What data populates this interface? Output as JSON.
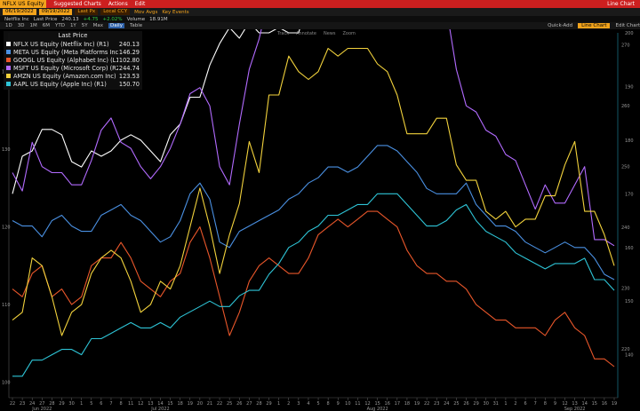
{
  "topbar": {
    "ticker": "NFLX US Equity",
    "menu": [
      "Suggested Charts",
      "Actions",
      "Edit"
    ],
    "title": "Line Chart"
  },
  "rangebar": {
    "start": "06/19/2022",
    "end": "09/19/2022",
    "field": "Last Px",
    "ccy": "Local CCY",
    "options": [
      "Mov Avgs",
      "Key Events"
    ]
  },
  "quotebar": {
    "name": "Netflix Inc",
    "label": "Last Price",
    "price": "240.13",
    "change": "+4.75",
    "pct": "+2.02%",
    "vol_label": "Volume",
    "volume": "18.91M"
  },
  "periodbar": {
    "periods": [
      "1D",
      "3D",
      "1M",
      "6M",
      "YTD",
      "1Y",
      "5Y",
      "Max"
    ],
    "freq": "Daily",
    "extra": [
      "Table"
    ],
    "right": [
      "Quick-Add",
      "Edit Chart"
    ],
    "field": "Line Chart"
  },
  "legend": {
    "header": "Last Price",
    "items": [
      {
        "name": "NFLX US Equity (Netflix Inc)  (R1)",
        "value": "240.13",
        "color": "#ffffff"
      },
      {
        "name": "META US Equity (Meta Platforms Inc)  (R1)",
        "value": "146.29",
        "color": "#4a90e2"
      },
      {
        "name": "GOOGL US Equity (Alphabet Inc)  (L1)",
        "value": "102.80",
        "color": "#e8562a"
      },
      {
        "name": "MSFT US Equity (Microsoft Corp)  (R2)",
        "value": "244.74",
        "color": "#b26bff"
      },
      {
        "name": "AMZN US Equity (Amazon.com Inc)  (L1)",
        "value": "123.53",
        "color": "#f2d23c"
      },
      {
        "name": "AAPL US Equity (Apple Inc)  (R1)",
        "value": "150.70",
        "color": "#2ec4d6"
      }
    ]
  },
  "toolbar": [
    "Track",
    "Annotate",
    "News",
    "Zoom"
  ],
  "chart_data": {
    "type": "line",
    "x_tick_labels": [
      "22",
      "23",
      "24",
      "27",
      "28",
      "29",
      "30",
      "1",
      "5",
      "6",
      "7",
      "8",
      "11",
      "12",
      "13",
      "14",
      "15",
      "18",
      "19",
      "20",
      "21",
      "22",
      "25",
      "26",
      "27",
      "28",
      "29",
      "1",
      "2",
      "3",
      "4",
      "5",
      "8",
      "9",
      "10",
      "11",
      "12",
      "15",
      "16",
      "17",
      "18",
      "19",
      "22",
      "23",
      "24",
      "25",
      "26",
      "29",
      "30",
      "31",
      "1",
      "2",
      "6",
      "7",
      "8",
      "9",
      "12",
      "13",
      "14",
      "15",
      "16",
      "19"
    ],
    "x_month_labels": [
      {
        "label": "Jun 2022",
        "index": 3
      },
      {
        "label": "Jul 2022",
        "index": 15
      },
      {
        "label": "Aug 2022",
        "index": 37
      },
      {
        "label": "Sep 2022",
        "index": 57
      }
    ],
    "left_axis": {
      "ticks": [
        100,
        110,
        120,
        130,
        140
      ],
      "range": [
        98,
        145
      ]
    },
    "right_axis_1": {
      "ticks": [
        140,
        150,
        160,
        170,
        180,
        190,
        200,
        210
      ],
      "range": [
        132,
        200
      ]
    },
    "right_axis_2": {
      "ticks": [
        220,
        230,
        240,
        250,
        260,
        270,
        280
      ],
      "range": [
        212,
        272
      ]
    },
    "series": [
      {
        "name": "NFLX US Equity (Netflix Inc)",
        "axis": "right_axis_1",
        "color": "#ffffff",
        "values": [
          170,
          177,
          178,
          182,
          182,
          181,
          176,
          175,
          178,
          177,
          178,
          180,
          181,
          180,
          178,
          176,
          181,
          183,
          188,
          188,
          194,
          198,
          201,
          199,
          202,
          200,
          200,
          201,
          200,
          200,
          206,
          215,
          221,
          223,
          225,
          228,
          225,
          229,
          228,
          227,
          222,
          219,
          210,
          210,
          212,
          211,
          215,
          211,
          211,
          215,
          212,
          213,
          213,
          212,
          214,
          214,
          217,
          218,
          214,
          214,
          222,
          224
        ]
      },
      {
        "name": "META US Equity (Meta Platforms Inc)",
        "axis": "right_axis_1",
        "color": "#4a90e2",
        "values": [
          165,
          164,
          164,
          162,
          165,
          166,
          164,
          163,
          163,
          166,
          167,
          168,
          166,
          165,
          163,
          161,
          162,
          165,
          170,
          172,
          169,
          161,
          160,
          163,
          164,
          165,
          166,
          167,
          169,
          170,
          172,
          173,
          175,
          175,
          174,
          175,
          177,
          179,
          179,
          178,
          176,
          174,
          171,
          170,
          170,
          170,
          172,
          168,
          166,
          164,
          164,
          163,
          161,
          160,
          159,
          160,
          161,
          160,
          160,
          158,
          155,
          154
        ]
      },
      {
        "name": "GOOGL US Equity (Alphabet Inc)",
        "axis": "left_axis",
        "color": "#e8562a",
        "values": [
          112,
          111,
          114,
          115,
          111,
          112,
          110,
          111,
          115,
          116,
          116,
          118,
          116,
          113,
          112,
          111,
          113,
          114,
          118,
          120,
          116,
          111,
          106,
          109,
          113,
          115,
          116,
          115,
          114,
          114,
          116,
          119,
          120,
          121,
          120,
          121,
          122,
          122,
          121,
          120,
          117,
          115,
          114,
          114,
          113,
          113,
          112,
          110,
          109,
          108,
          108,
          107,
          107,
          107,
          106,
          108,
          109,
          107,
          106,
          103,
          103,
          102
        ]
      },
      {
        "name": "MSFT US Equity (Microsoft Corp)",
        "axis": "right_axis_2",
        "color": "#b26bff",
        "values": [
          249,
          246,
          254,
          250,
          249,
          249,
          247,
          247,
          251,
          256,
          258,
          254,
          253,
          250,
          248,
          250,
          253,
          257,
          262,
          263,
          260,
          250,
          247,
          257,
          266,
          271,
          278,
          278,
          282,
          282,
          283,
          286,
          285,
          285,
          288,
          290,
          291,
          289,
          287,
          288,
          285,
          279,
          277,
          276,
          276,
          266,
          260,
          259,
          256,
          255,
          252,
          251,
          247,
          243,
          247,
          244,
          244,
          247,
          250,
          238,
          238,
          237
        ]
      },
      {
        "name": "AMZN US Equity (Amazon.com Inc)",
        "axis": "left_axis",
        "color": "#f2d23c",
        "values": [
          108,
          109,
          116,
          115,
          111,
          106,
          109,
          110,
          114,
          116,
          117,
          116,
          113,
          109,
          110,
          113,
          112,
          115,
          120,
          125,
          120,
          114,
          119,
          123,
          131,
          127,
          137,
          137,
          142,
          140,
          139,
          140,
          143,
          142,
          143,
          143,
          143,
          141,
          140,
          137,
          132,
          132,
          132,
          134,
          134,
          128,
          126,
          126,
          122,
          121,
          122,
          120,
          121,
          121,
          124,
          124,
          128,
          131,
          122,
          122,
          119,
          115
        ]
      },
      {
        "name": "AAPL US Equity (Apple Inc)",
        "axis": "right_axis_1",
        "color": "#2ec4d6",
        "values": [
          136,
          136,
          139,
          139,
          140,
          141,
          141,
          140,
          143,
          143,
          144,
          145,
          146,
          145,
          145,
          146,
          145,
          147,
          148,
          149,
          150,
          149,
          149,
          151,
          152,
          152,
          155,
          157,
          160,
          161,
          163,
          164,
          166,
          166,
          167,
          168,
          168,
          170,
          170,
          170,
          168,
          166,
          164,
          164,
          165,
          167,
          168,
          165,
          163,
          162,
          161,
          159,
          158,
          157,
          156,
          157,
          157,
          157,
          158,
          154,
          154,
          152
        ]
      }
    ]
  }
}
